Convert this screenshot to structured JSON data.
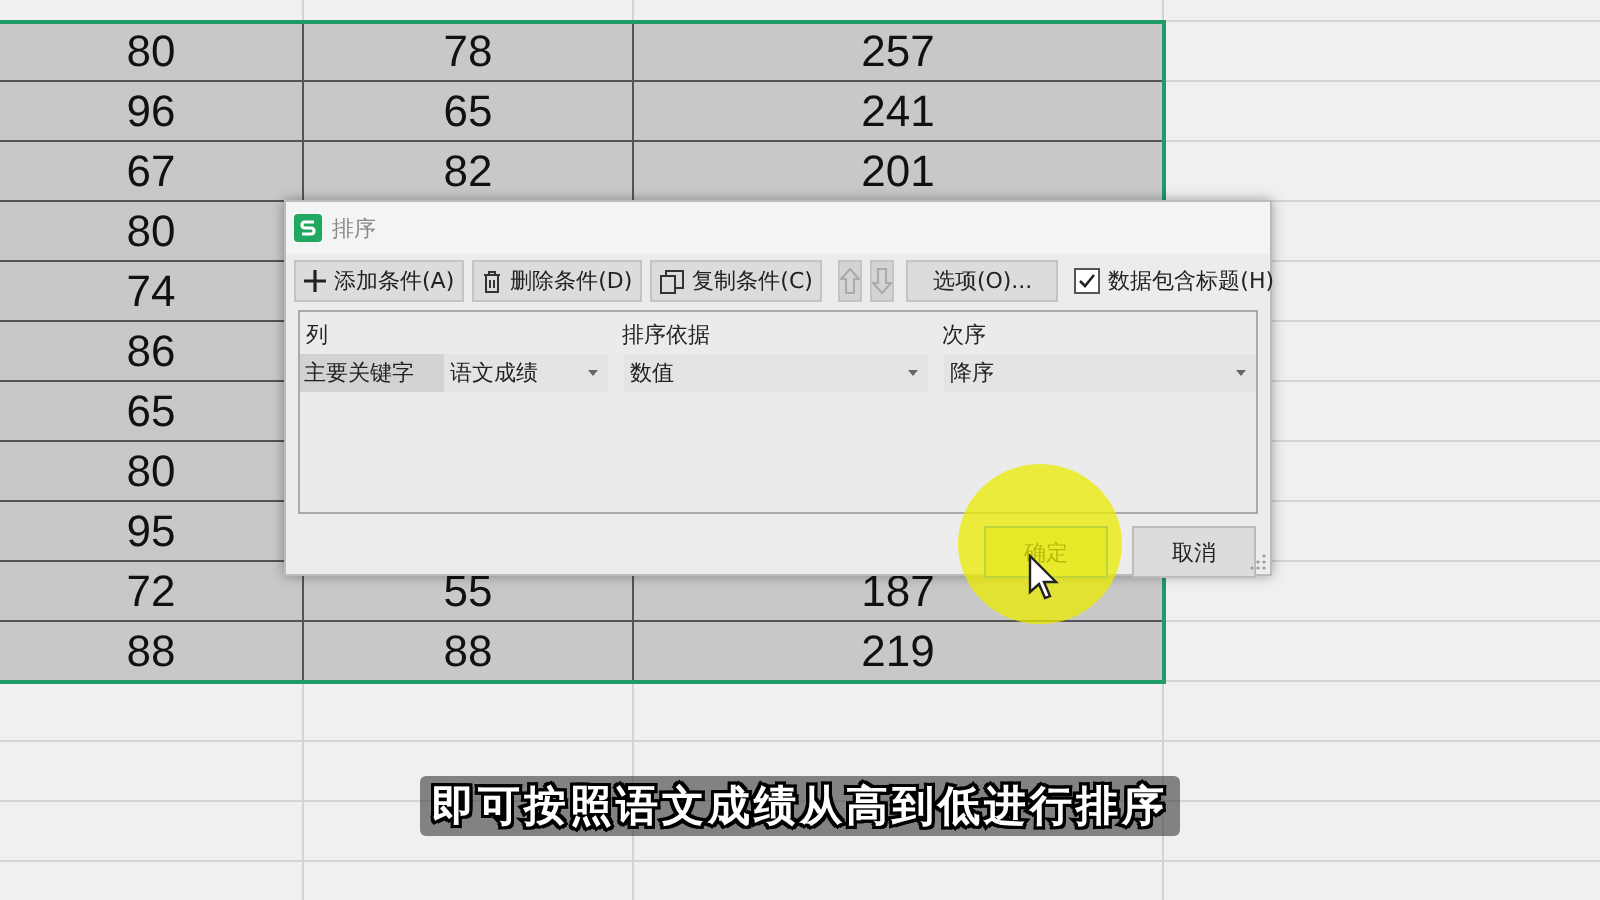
{
  "sheet": {
    "rows": [
      [
        "80",
        "78",
        "257"
      ],
      [
        "96",
        "65",
        "241"
      ],
      [
        "67",
        "82",
        "201"
      ],
      [
        "80"
      ],
      [
        "74"
      ],
      [
        "86"
      ],
      [
        "65"
      ],
      [
        "80"
      ],
      [
        "95"
      ],
      [
        "72",
        "55",
        "187"
      ],
      [
        "88",
        "88",
        "219"
      ]
    ]
  },
  "dialog": {
    "title": "排序",
    "toolbar": [
      {
        "kind": "add",
        "label": "添加条件(A)",
        "disabled": false
      },
      {
        "kind": "delete",
        "label": "删除条件(D)",
        "disabled": false
      },
      {
        "kind": "copy",
        "label": "复制条件(C)",
        "disabled": false
      },
      {
        "kind": "up",
        "disabled": true
      },
      {
        "kind": "down",
        "disabled": true
      },
      {
        "kind": "text",
        "label": "选项(O)...",
        "disabled": false
      }
    ],
    "header_checkbox": {
      "label": "数据包含标题(H)",
      "checked": true
    },
    "columns": [
      "列",
      "排序依据",
      "次序"
    ],
    "conditions": [
      {
        "label": "主要关键字",
        "column": "语文成绩",
        "basis": "数值",
        "order": "降序"
      }
    ],
    "buttons": [
      {
        "label": "确定",
        "kind": "primary"
      },
      {
        "label": "取消",
        "kind": "normal"
      }
    ]
  },
  "subtitle": "即可按照语文成绩从高到低进行排序"
}
